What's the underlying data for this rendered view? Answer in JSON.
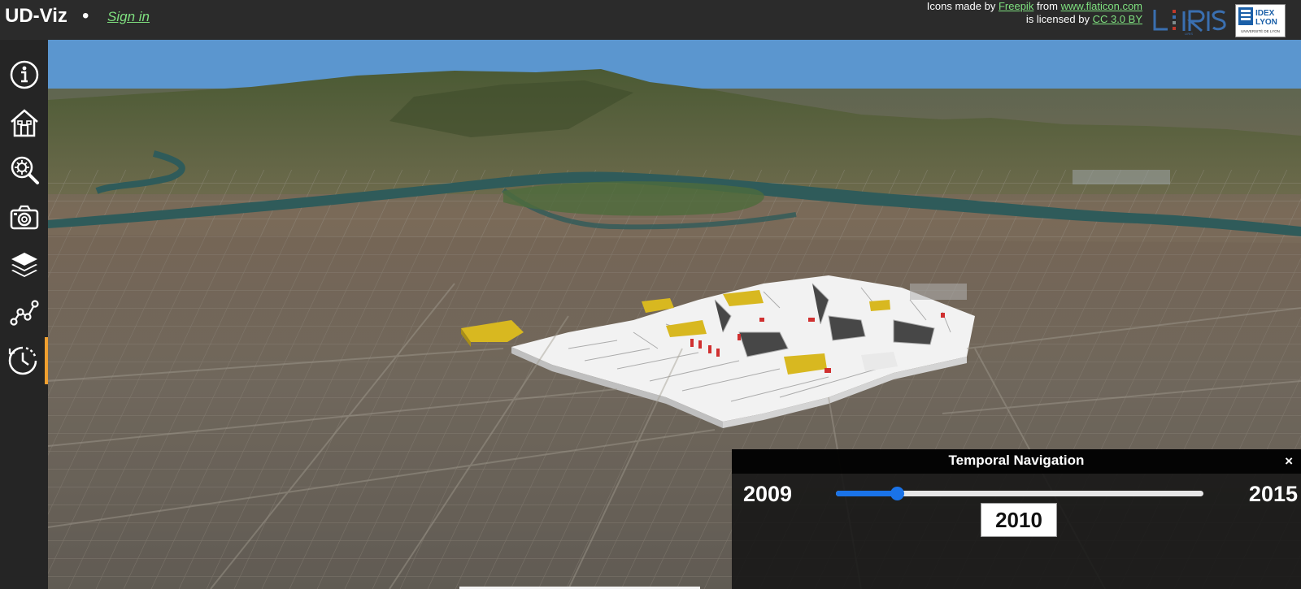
{
  "header": {
    "app_title": "UD-Viz",
    "title_dot": "•",
    "sign_in": "Sign in",
    "credits": {
      "prefix": "Icons made by",
      "author": "Freepik",
      "from": "from",
      "site": "www.flaticon.com",
      "license_prefix": "is licensed by",
      "license": "CC 3.0 BY"
    },
    "logo_liris": "LIRIS",
    "logo_idex_line1": "IDEX",
    "logo_idex_line2": "LYON",
    "logo_idex_line3": "UNIVERSITÉ DE LYON"
  },
  "sidebar": {
    "items": [
      {
        "icon": "info-icon",
        "active": false
      },
      {
        "icon": "home-icon",
        "active": false
      },
      {
        "icon": "city-object-search-icon",
        "active": false
      },
      {
        "icon": "camera-icon",
        "active": false
      },
      {
        "icon": "layers-icon",
        "active": false
      },
      {
        "icon": "graph-icon",
        "active": false
      },
      {
        "icon": "temporal-clock-icon",
        "active": true
      }
    ]
  },
  "temporal": {
    "title": "Temporal Navigation",
    "close": "×",
    "min_year": "2009",
    "max_year": "2015",
    "current_year": "2010",
    "slider_value": 2010,
    "slider_min": 2009,
    "slider_max": 2015
  },
  "colors": {
    "accent": "#f0a030",
    "slider": "#1a73e8",
    "link": "#7fe07f",
    "building": "#f2f2f2",
    "building_highlight": "#d8b820",
    "building_modified": "#d03030",
    "sky": "#5b96cf"
  }
}
